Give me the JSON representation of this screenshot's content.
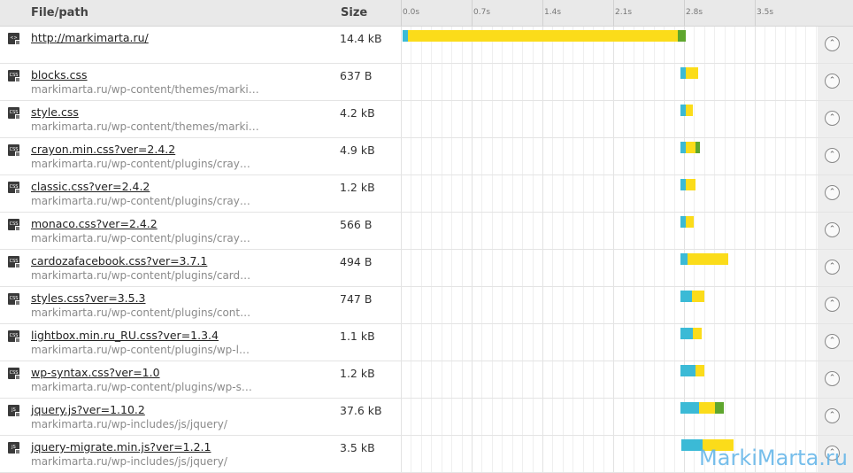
{
  "header": {
    "file_label": "File/path",
    "size_label": "Size",
    "ticks": [
      "0.0s",
      "0.7s",
      "1.4s",
      "2.1s",
      "2.8s",
      "3.5s"
    ]
  },
  "rows": [
    {
      "icon": "html-file-icon",
      "icon_text": "<>",
      "name": "http://markimarta.ru/",
      "path": "",
      "size": "14.4 kB",
      "segments": [
        {
          "color": "#3bbad6",
          "start": 0.0,
          "dur": 0.05
        },
        {
          "color": "#fbdc1a",
          "start": 0.05,
          "dur": 2.67
        },
        {
          "color": "#5ea62d",
          "start": 2.72,
          "dur": 0.08
        }
      ]
    },
    {
      "icon": "css-file-icon",
      "icon_text": "CSS",
      "name": "blocks.css",
      "path": "markimarta.ru/wp-content/themes/marki…",
      "size": "637 B",
      "segments": [
        {
          "color": "#3bbad6",
          "start": 2.75,
          "dur": 0.05
        },
        {
          "color": "#fbdc1a",
          "start": 2.8,
          "dur": 0.12
        }
      ]
    },
    {
      "icon": "css-file-icon",
      "icon_text": "CSS",
      "name": "style.css",
      "path": "markimarta.ru/wp-content/themes/marki…",
      "size": "4.2 kB",
      "segments": [
        {
          "color": "#3bbad6",
          "start": 2.75,
          "dur": 0.05
        },
        {
          "color": "#fbdc1a",
          "start": 2.8,
          "dur": 0.07
        }
      ]
    },
    {
      "icon": "css-file-icon",
      "icon_text": "CSS",
      "name": "crayon.min.css?ver=2.4.2",
      "path": "markimarta.ru/wp-content/plugins/cray…",
      "size": "4.9 kB",
      "segments": [
        {
          "color": "#3bbad6",
          "start": 2.75,
          "dur": 0.05
        },
        {
          "color": "#fbdc1a",
          "start": 2.8,
          "dur": 0.1
        },
        {
          "color": "#5ea62d",
          "start": 2.9,
          "dur": 0.04
        }
      ]
    },
    {
      "icon": "css-file-icon",
      "icon_text": "CSS",
      "name": "classic.css?ver=2.4.2",
      "path": "markimarta.ru/wp-content/plugins/cray…",
      "size": "1.2 kB",
      "segments": [
        {
          "color": "#3bbad6",
          "start": 2.75,
          "dur": 0.05
        },
        {
          "color": "#fbdc1a",
          "start": 2.8,
          "dur": 0.1
        }
      ]
    },
    {
      "icon": "css-file-icon",
      "icon_text": "CSS",
      "name": "monaco.css?ver=2.4.2",
      "path": "markimarta.ru/wp-content/plugins/cray…",
      "size": "566 B",
      "segments": [
        {
          "color": "#3bbad6",
          "start": 2.75,
          "dur": 0.05
        },
        {
          "color": "#fbdc1a",
          "start": 2.8,
          "dur": 0.08
        }
      ]
    },
    {
      "icon": "css-file-icon",
      "icon_text": "CSS",
      "name": "cardozafacebook.css?ver=3.7.1",
      "path": "markimarta.ru/wp-content/plugins/card…",
      "size": "494 B",
      "segments": [
        {
          "color": "#3bbad6",
          "start": 2.75,
          "dur": 0.07
        },
        {
          "color": "#fbdc1a",
          "start": 2.82,
          "dur": 0.4
        }
      ]
    },
    {
      "icon": "css-file-icon",
      "icon_text": "CSS",
      "name": "styles.css?ver=3.5.3",
      "path": "markimarta.ru/wp-content/plugins/cont…",
      "size": "747 B",
      "segments": [
        {
          "color": "#3bbad6",
          "start": 2.75,
          "dur": 0.11
        },
        {
          "color": "#fbdc1a",
          "start": 2.86,
          "dur": 0.12
        }
      ]
    },
    {
      "icon": "css-file-icon",
      "icon_text": "CSS",
      "name": "lightbox.min.ru_RU.css?ver=1.3.4",
      "path": "markimarta.ru/wp-content/plugins/wp-l…",
      "size": "1.1 kB",
      "segments": [
        {
          "color": "#3bbad6",
          "start": 2.75,
          "dur": 0.12
        },
        {
          "color": "#fbdc1a",
          "start": 2.87,
          "dur": 0.09
        }
      ]
    },
    {
      "icon": "css-file-icon",
      "icon_text": "CSS",
      "name": "wp-syntax.css?ver=1.0",
      "path": "markimarta.ru/wp-content/plugins/wp-s…",
      "size": "1.2 kB",
      "segments": [
        {
          "color": "#3bbad6",
          "start": 2.75,
          "dur": 0.15
        },
        {
          "color": "#fbdc1a",
          "start": 2.9,
          "dur": 0.08
        }
      ]
    },
    {
      "icon": "js-file-icon",
      "icon_text": "JS",
      "name": "jquery.js?ver=1.10.2",
      "path": "markimarta.ru/wp-includes/js/jquery/",
      "size": "37.6 kB",
      "segments": [
        {
          "color": "#3bbad6",
          "start": 2.75,
          "dur": 0.18
        },
        {
          "color": "#fbdc1a",
          "start": 2.93,
          "dur": 0.16
        },
        {
          "color": "#5ea62d",
          "start": 3.09,
          "dur": 0.09
        }
      ]
    },
    {
      "icon": "js-file-icon",
      "icon_text": "JS",
      "name": "jquery-migrate.min.js?ver=1.2.1",
      "path": "markimarta.ru/wp-includes/js/jquery/",
      "size": "3.5 kB",
      "segments": [
        {
          "color": "#3bbad6",
          "start": 2.76,
          "dur": 0.21
        },
        {
          "color": "#fbdc1a",
          "start": 2.97,
          "dur": 0.3
        }
      ]
    }
  ],
  "watermark": "MarkiMarta.ru"
}
